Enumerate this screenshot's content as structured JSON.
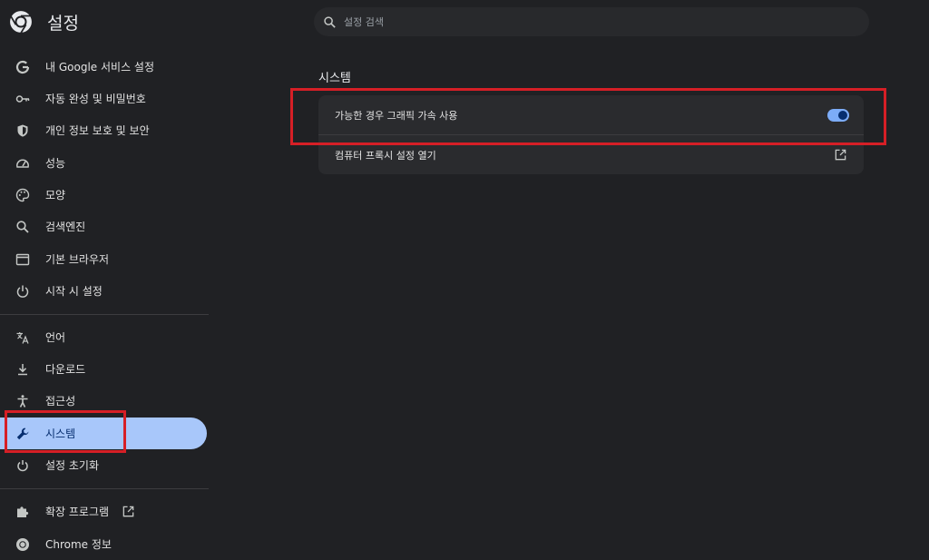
{
  "header": {
    "title": "설정"
  },
  "search": {
    "placeholder": "설정 검색"
  },
  "sidebar": {
    "items": [
      {
        "label": "내 Google 서비스 설정",
        "icon": "google-icon"
      },
      {
        "label": "자동 완성 및 비밀번호",
        "icon": "key-icon"
      },
      {
        "label": "개인 정보 보호 및 보안",
        "icon": "shield-icon"
      },
      {
        "label": "성능",
        "icon": "speedometer-icon"
      },
      {
        "label": "모양",
        "icon": "palette-icon"
      },
      {
        "label": "검색엔진",
        "icon": "search-icon"
      },
      {
        "label": "기본 브라우저",
        "icon": "browser-window-icon"
      },
      {
        "label": "시작 시 설정",
        "icon": "power-icon"
      },
      {
        "label": "언어",
        "icon": "translate-icon"
      },
      {
        "label": "다운로드",
        "icon": "download-icon"
      },
      {
        "label": "접근성",
        "icon": "accessibility-icon"
      },
      {
        "label": "시스템",
        "icon": "wrench-icon",
        "active": true
      },
      {
        "label": "설정 초기화",
        "icon": "reset-icon"
      },
      {
        "label": "확장 프로그램",
        "icon": "puzzle-icon"
      },
      {
        "label": "Chrome 정보",
        "icon": "chrome-icon"
      }
    ]
  },
  "main": {
    "section_title": "시스템",
    "rows": [
      {
        "label": "가능한 경우 그래픽 가속 사용",
        "control": "toggle",
        "toggle_on": true
      },
      {
        "label": "컴퓨터 프록시 설정 열기",
        "control": "external-link-icon"
      }
    ]
  },
  "colors": {
    "background": "#202124",
    "active_nav": "#a8c7fa",
    "toggle_track": "#7cacf8",
    "highlight_box": "#d61f26"
  }
}
